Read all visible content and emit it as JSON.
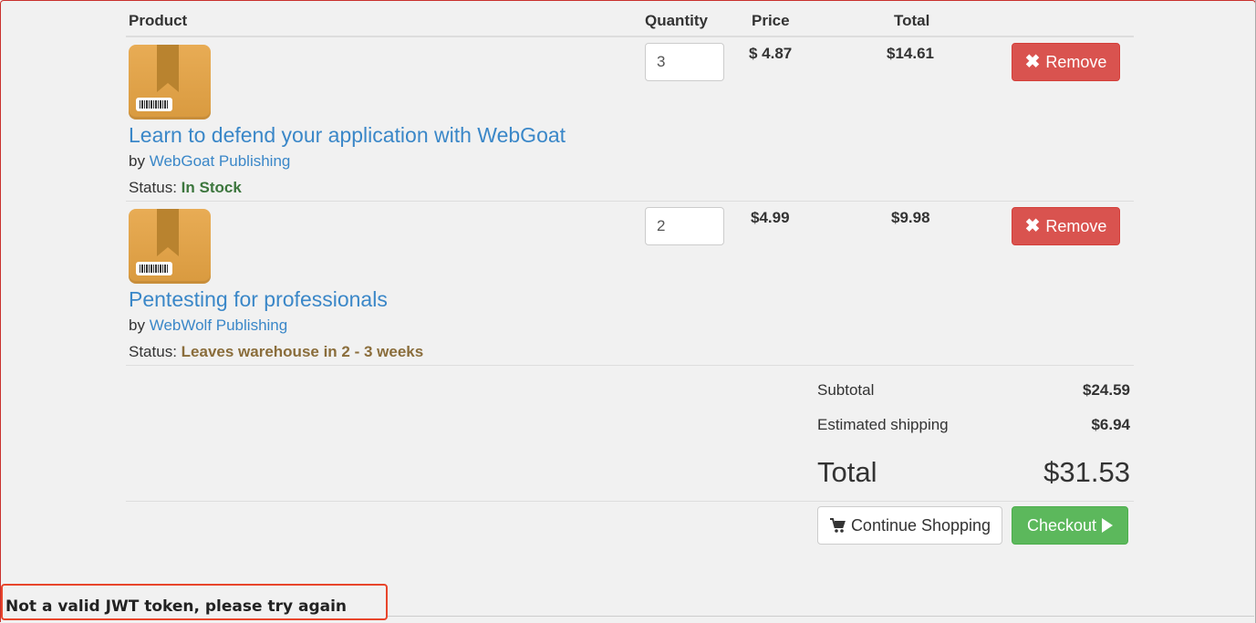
{
  "table": {
    "headers": {
      "product": "Product",
      "quantity": "Quantity",
      "price": "Price",
      "total": "Total"
    }
  },
  "items": [
    {
      "title": "Learn to defend your application with WebGoat",
      "by_label": "by",
      "publisher": "WebGoat Publishing",
      "status_label": "Status:",
      "status": "In Stock",
      "quantity": "3",
      "price": "$ 4.87",
      "total": "$14.61",
      "remove_label": "Remove"
    },
    {
      "title": "Pentesting for professionals",
      "by_label": "by",
      "publisher": "WebWolf Publishing",
      "status_label": "Status:",
      "status": "Leaves warehouse in 2 - 3 weeks",
      "quantity": "2",
      "price": "$4.99",
      "total": "$9.98",
      "remove_label": "Remove"
    }
  ],
  "summary": {
    "subtotal_label": "Subtotal",
    "subtotal": "$24.59",
    "shipping_label": "Estimated shipping",
    "shipping": "$6.94",
    "total_label": "Total",
    "total": "$31.53"
  },
  "actions": {
    "continue_label": "Continue Shopping",
    "checkout_label": "Checkout"
  },
  "feedback": {
    "message": "Not a valid JWT token, please try again"
  },
  "colors": {
    "link": "#3a87c8",
    "danger": "#d9534f",
    "success": "#5cb85c",
    "in_stock": "#3c763d",
    "warning": "#8a6d3b",
    "feedback_border": "#e8452b"
  },
  "icons": [
    "remove-icon",
    "cart-icon",
    "play-icon",
    "package-icon"
  ]
}
